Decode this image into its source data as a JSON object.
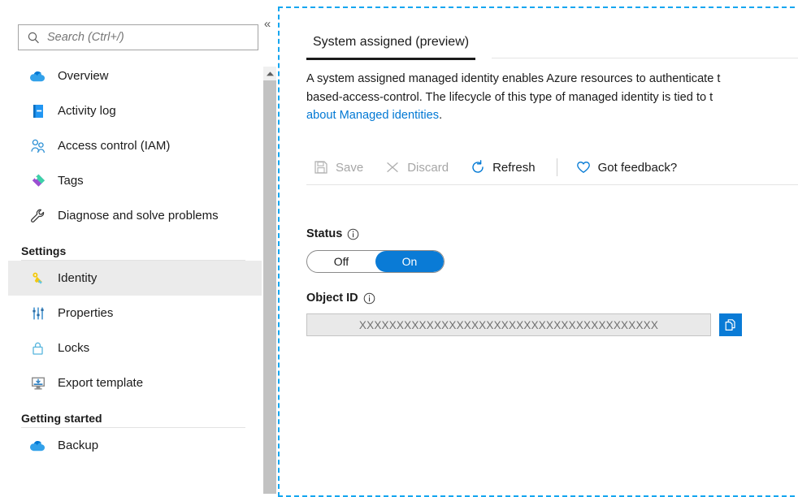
{
  "sidebar": {
    "search": {
      "placeholder": "Search (Ctrl+/)",
      "value": "",
      "icon": "search-icon"
    },
    "collapse_label": "«",
    "items": [
      {
        "label": "Overview",
        "icon": "cloud-icon",
        "type": "item",
        "selected": false
      },
      {
        "label": "Activity log",
        "icon": "book-icon",
        "type": "item",
        "selected": false
      },
      {
        "label": "Access control (IAM)",
        "icon": "people-icon",
        "type": "item",
        "selected": false
      },
      {
        "label": "Tags",
        "icon": "tag-icon",
        "type": "item",
        "selected": false
      },
      {
        "label": "Diagnose and solve problems",
        "icon": "wrench-icon",
        "type": "item",
        "selected": false
      },
      {
        "label": "Settings",
        "icon": "",
        "type": "group",
        "selected": false
      },
      {
        "label": "Identity",
        "icon": "key-icon",
        "type": "item",
        "selected": true
      },
      {
        "label": "Properties",
        "icon": "sliders-icon",
        "type": "item",
        "selected": false
      },
      {
        "label": "Locks",
        "icon": "lock-icon",
        "type": "item",
        "selected": false
      },
      {
        "label": "Export template",
        "icon": "export-icon",
        "type": "item",
        "selected": false
      },
      {
        "label": "Getting started",
        "icon": "",
        "type": "group",
        "selected": false
      },
      {
        "label": "Backup",
        "icon": "cloud-icon",
        "type": "item",
        "selected": false
      }
    ],
    "scrollbar": {
      "up_arrow": "scroll-up-arrow"
    }
  },
  "main": {
    "tabs": [
      {
        "label": "System assigned (preview)",
        "active": true
      }
    ],
    "description": {
      "text_before_link": "A system assigned managed identity enables Azure resources to authenticate t\nbased-access-control. The lifecycle of this type of managed identity is tied to t\n",
      "link_text": "about Managed identities",
      "text_after_link": "."
    },
    "toolbar": {
      "buttons": [
        {
          "label": "Save",
          "icon": "save-icon",
          "disabled": true
        },
        {
          "label": "Discard",
          "icon": "discard-icon",
          "disabled": true
        },
        {
          "label": "Refresh",
          "icon": "refresh-icon",
          "disabled": false
        },
        {
          "label": "Got feedback?",
          "icon": "heart-icon",
          "disabled": false
        }
      ]
    },
    "status": {
      "label": "Status",
      "info_icon": "info-icon",
      "options": [
        "Off",
        "On"
      ],
      "selected": "On"
    },
    "object_id": {
      "label": "Object ID",
      "info_icon": "info-icon",
      "value": "XXXXXXXXXXXXXXXXXXXXXXXXXXXXXXXXXXXXXXXX",
      "copy_button_icon": "copy-icon"
    }
  },
  "annotation": {
    "type": "dashed-highlight-box",
    "color": "#15a6f0"
  },
  "colors": {
    "accent": "#0078d4",
    "toggle_on": "#0a7bd6",
    "selected_nav_bg": "#ebebeb",
    "annotation": "#15a6f0",
    "disabled_text": "#a6a6a6"
  }
}
